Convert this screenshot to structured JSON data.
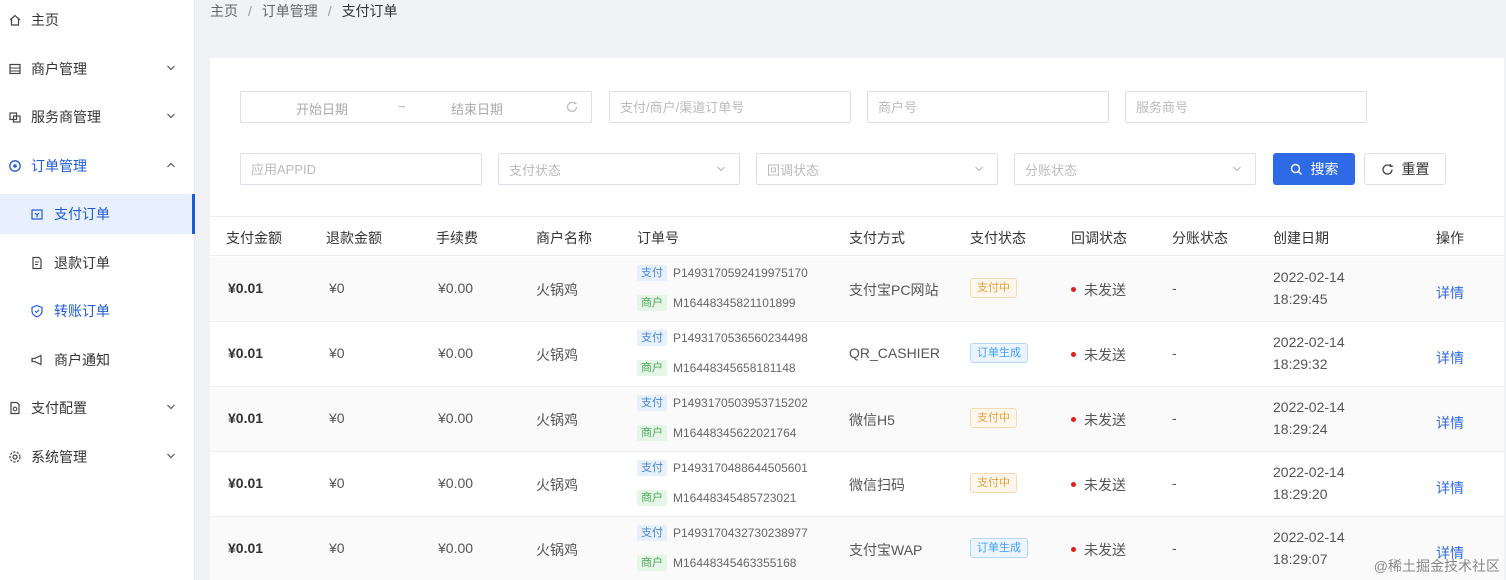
{
  "sidebar": {
    "items": [
      {
        "label": "主页"
      },
      {
        "label": "商户管理"
      },
      {
        "label": "服务商管理"
      },
      {
        "label": "订单管理"
      },
      {
        "label": "支付订单"
      },
      {
        "label": "退款订单"
      },
      {
        "label": "转账订单"
      },
      {
        "label": "商户通知"
      },
      {
        "label": "支付配置"
      },
      {
        "label": "系统管理"
      }
    ]
  },
  "breadcrumb": [
    "主页",
    "订单管理",
    "支付订单"
  ],
  "filters": {
    "start_date": "开始日期",
    "date_sep": "~",
    "end_date": "结束日期",
    "order_no": "支付/商户/渠道订单号",
    "mch_no": "商户号",
    "isv_no": "服务商号",
    "app_id": "应用APPID",
    "pay_state": "支付状态",
    "notify_state": "回调状态",
    "division_state": "分账状态",
    "search_label": "搜索",
    "reset_label": "重置"
  },
  "table": {
    "headers": [
      "支付金额",
      "退款金额",
      "手续费",
      "商户名称",
      "订单号",
      "支付方式",
      "支付状态",
      "回调状态",
      "分账状态",
      "创建日期",
      "操作"
    ],
    "pay_tag": "支付",
    "mch_tag": "商户",
    "rows": [
      {
        "amount": "¥0.01",
        "refund": "¥0",
        "fee": "¥0.00",
        "mch_name": "火锅鸡",
        "pay_order": "P1493170592419975170",
        "mch_order": "M16448345821101899",
        "way": "支付宝PC网站",
        "state": "支付中",
        "notify": "未发送",
        "division": "-",
        "date": "2022-02-14",
        "time": "18:29:45",
        "action": "详情"
      },
      {
        "amount": "¥0.01",
        "refund": "¥0",
        "fee": "¥0.00",
        "mch_name": "火锅鸡",
        "pay_order": "P1493170536560234498",
        "mch_order": "M16448345658181148",
        "way": "QR_CASHIER",
        "state": "订单生成",
        "notify": "未发送",
        "division": "-",
        "date": "2022-02-14",
        "time": "18:29:32",
        "action": "详情"
      },
      {
        "amount": "¥0.01",
        "refund": "¥0",
        "fee": "¥0.00",
        "mch_name": "火锅鸡",
        "pay_order": "P1493170503953715202",
        "mch_order": "M16448345622021764",
        "way": "微信H5",
        "state": "支付中",
        "notify": "未发送",
        "division": "-",
        "date": "2022-02-14",
        "time": "18:29:24",
        "action": "详情"
      },
      {
        "amount": "¥0.01",
        "refund": "¥0",
        "fee": "¥0.00",
        "mch_name": "火锅鸡",
        "pay_order": "P1493170488644505601",
        "mch_order": "M16448345485723021",
        "way": "微信扫码",
        "state": "支付中",
        "notify": "未发送",
        "division": "-",
        "date": "2022-02-14",
        "time": "18:29:20",
        "action": "详情"
      },
      {
        "amount": "¥0.01",
        "refund": "¥0",
        "fee": "¥0.00",
        "mch_name": "火锅鸡",
        "pay_order": "P1493170432730238977",
        "mch_order": "M16448345463355168",
        "way": "支付宝WAP",
        "state": "订单生成",
        "notify": "未发送",
        "division": "-",
        "date": "2022-02-14",
        "time": "18:29:07",
        "action": "详情"
      }
    ]
  },
  "watermark": "@稀土掘金技术社区",
  "colors": {
    "accent": "#2f6ae6",
    "paying": "#e6a23c",
    "created": "#409eff",
    "dot": "#e02020"
  }
}
